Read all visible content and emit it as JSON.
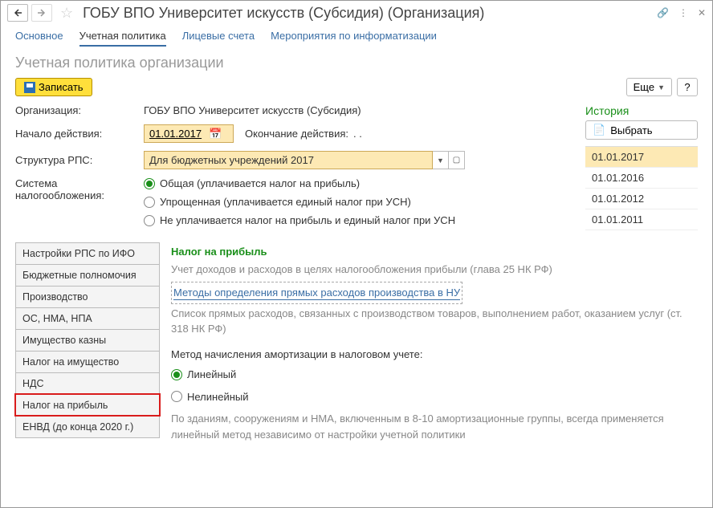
{
  "titlebar": {
    "title": "ГОБУ ВПО Университет искусств (Субсидия) (Организация)"
  },
  "tabs": [
    {
      "label": "Основное"
    },
    {
      "label": "Учетная политика"
    },
    {
      "label": "Лицевые счета"
    },
    {
      "label": "Мероприятия по информатизации"
    }
  ],
  "page_header": "Учетная политика организации",
  "toolbar": {
    "save_label": "Записать",
    "more_label": "Еще",
    "help_label": "?"
  },
  "form": {
    "org_label": "Организация:",
    "org_value": "ГОБУ ВПО Университет искусств (Субсидия)",
    "start_label": "Начало действия:",
    "start_value": "01.01.2017",
    "end_label": "Окончание действия:",
    "end_value": ". .",
    "rps_label": "Структура РПС:",
    "rps_value": "Для бюджетных учреждений 2017",
    "tax_label": "Система налогообложения:",
    "tax_options": {
      "0": "Общая (уплачивается налог на прибыль)",
      "1": "Упрощенная (уплачивается единый налог при УСН)",
      "2": "Не уплачивается налог на прибыль и единый налог при УСН"
    }
  },
  "side_tabs": {
    "0": "Настройки РПС по ИФО",
    "1": "Бюджетные полномочия",
    "2": "Производство",
    "3": "ОС, НМА, НПА",
    "4": "Имущество казны",
    "5": "Налог на имущество",
    "6": "НДС",
    "7": "Налог на прибыль",
    "8": "ЕНВД (до конца 2020 г.)"
  },
  "content": {
    "heading": "Налог на прибыль",
    "sub1": "Учет доходов и расходов в целях налогообложения прибыли (глава 25 НК РФ)",
    "link": "Методы определения прямых расходов производства в НУ",
    "sub2": "Список прямых расходов, связанных с производством товаров, выполнением работ, оказанием услуг (ст. 318 НК РФ)",
    "method_label": "Метод начисления амортизации в налоговом учете:",
    "method_options": {
      "0": "Линейный",
      "1": "Нелинейный"
    },
    "note": "По зданиям, сооружениям и НМА, включенным в 8-10 амортизационные группы, всегда применяется линейный метод независимо от настройки учетной политики"
  },
  "history": {
    "title": "История",
    "select_label": "Выбрать",
    "items": {
      "0": "01.01.2017",
      "1": "01.01.2016",
      "2": "01.01.2012",
      "3": "01.01.2011"
    }
  }
}
